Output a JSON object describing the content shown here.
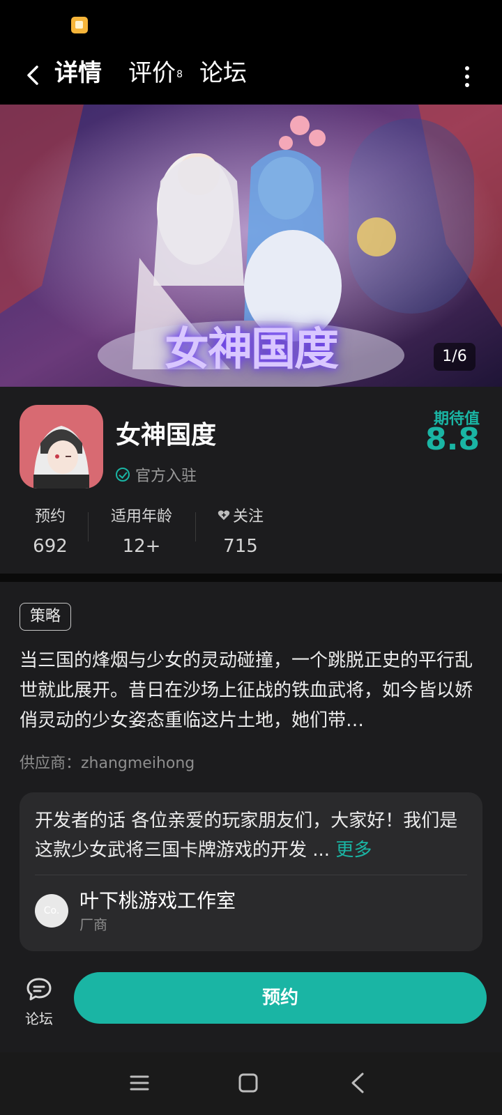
{
  "status_bar": {
    "notification_icon": "gallery-icon"
  },
  "nav": {
    "tabs": [
      {
        "label": "详情",
        "active": true
      },
      {
        "label": "评价",
        "badge": "8"
      },
      {
        "label": "论坛"
      }
    ],
    "back_icon": "chevron-left-icon",
    "more_icon": "more-vertical-icon"
  },
  "banner": {
    "title": "女神国度",
    "page_indicator": "1/6"
  },
  "app": {
    "name": "女神国度",
    "official_label": "官方入驻",
    "expect_label": "期待值",
    "expect_value": "8.8",
    "accent_color": "#1ab5a4"
  },
  "stats": [
    {
      "label": "预约",
      "value": "692"
    },
    {
      "label": "适用年龄",
      "value": "12+"
    },
    {
      "label": "关注",
      "value": "715",
      "icon": "heart-plus-icon"
    }
  ],
  "description": {
    "tag": "策略",
    "text": "当三国的烽烟与少女的灵动碰撞，一个跳脱正史的平行乱世就此展开。昔日在沙场上征战的铁血武将，如今皆以娇俏灵动的少女姿态重临这片土地，她们带…",
    "supplier": "供应商：zhangmeihong"
  },
  "developer": {
    "text": "开发者的话  各位亲爱的玩家朋友们，大家好！我们是这款少女武将三国卡牌游戏的开发 ...",
    "more_label": "更多",
    "studio_avatar_text": "Co.",
    "studio_name": "叶下桃游戏工作室",
    "studio_role": "厂商"
  },
  "bottom": {
    "forum_label": "论坛",
    "reserve_label": "预约"
  },
  "system_nav": {
    "recent_icon": "menu-icon",
    "home_icon": "square-icon",
    "back_icon": "back-triangle-icon"
  }
}
